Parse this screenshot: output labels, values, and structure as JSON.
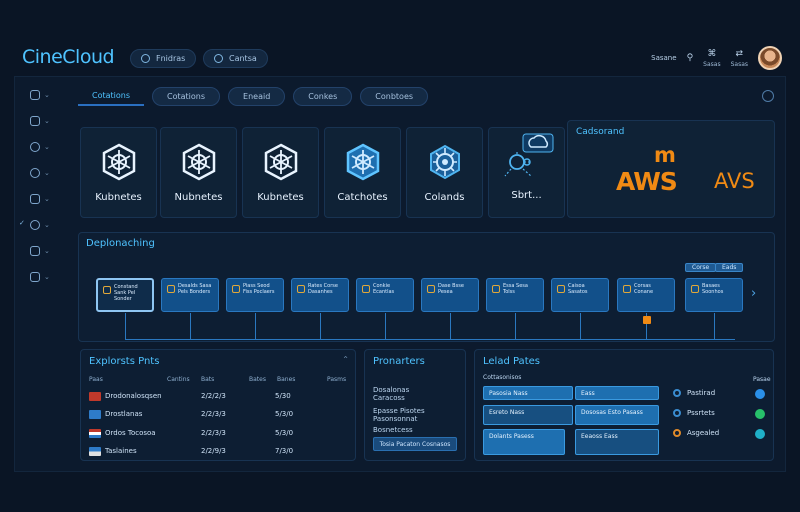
{
  "app": {
    "title": "CineCloud"
  },
  "top_nav": [
    {
      "label": "Fnidras"
    },
    {
      "label": "Cantsa"
    }
  ],
  "top_right": {
    "search_label": "Sasane",
    "items": [
      {
        "label": "Sasas",
        "icon": "network-icon"
      },
      {
        "label": "Sasas",
        "icon": "share-icon"
      }
    ]
  },
  "sidebar": {
    "items": [
      {
        "icon": "cluster-icon"
      },
      {
        "icon": "document-icon"
      },
      {
        "icon": "settings-icon"
      },
      {
        "icon": "clock-icon"
      },
      {
        "icon": "terminal-icon"
      },
      {
        "icon": "cloud-icon",
        "active": true
      },
      {
        "icon": "storage-icon"
      },
      {
        "icon": "shield-icon"
      }
    ]
  },
  "tabs": [
    {
      "label": "Cotations",
      "active": true
    },
    {
      "label": "Cotations"
    },
    {
      "label": "Eneaid"
    },
    {
      "label": "Conkes"
    },
    {
      "label": "Conbtoes"
    }
  ],
  "service_cards": [
    {
      "label": "Kubnetes"
    },
    {
      "label": "Nubnetes"
    },
    {
      "label": "Kubnetes"
    },
    {
      "label": "Catchotes"
    },
    {
      "label": "Colands"
    },
    {
      "label": "Sbrt..."
    }
  ],
  "aws_panel": {
    "header": "Cadsorand",
    "mark": "m",
    "logo_text": "AWS",
    "logo_text2": "AVS"
  },
  "pipeline": {
    "header": "Deplonaching",
    "controls": [
      "Corse",
      "Eads"
    ],
    "steps": [
      {
        "label": "Constand Sank Pel Sonder"
      },
      {
        "label": "Desalds Sasa Pels Bonders"
      },
      {
        "label": "Piass Seod Fiss Poclaers"
      },
      {
        "label": "Rates Corse Dasanhes"
      },
      {
        "label": "Conkie Ecantlas"
      },
      {
        "label": "Dase Bsse Pesea"
      },
      {
        "label": "Essa Sesa Tolss"
      },
      {
        "label": "Caisoa Sasatos"
      },
      {
        "label": "Corsas Conane"
      },
      {
        "label": "Basaes Soonhos"
      }
    ]
  },
  "explorer": {
    "header": "Explorsts Pnts",
    "columns": [
      "Paas",
      "Cantins",
      "Bats",
      "Bates",
      "Banes",
      "Pasms"
    ],
    "rows": [
      {
        "name": "Drodonalosqsen",
        "value": "2/2/2/3",
        "count": "5/30",
        "flag_color": "#c0392b"
      },
      {
        "name": "Drostlanas",
        "value": "2/2/3/3",
        "count": "5/3/0",
        "flag_color": "#2e7bc8"
      },
      {
        "name": "Ordos Tocosoa",
        "value": "2/2/3/3",
        "count": "5/3/0",
        "flag_color": "#d0d0d0"
      },
      {
        "name": "Taslaines",
        "value": "2/2/9/3",
        "count": "7/3/0",
        "flag_color": "#2e7bc8"
      }
    ]
  },
  "properties": {
    "header": "Pronarters",
    "lines": [
      "Dosalonas",
      "Caracoss",
      "Epasse Pisotes",
      "Pasonsonnat",
      "Bosnetcess"
    ],
    "button_label": "Tosia Pacaton Cosnasos"
  },
  "load_pates": {
    "header": "Lelad Pates",
    "subheader": "Cottasonisos",
    "boxes": [
      {
        "label": "Pasosia Nass"
      },
      {
        "label": "Esreto Nass"
      },
      {
        "label": "Dolants Pasess"
      },
      {
        "label": "Eass"
      },
      {
        "label": "Dososas Esto Pasass"
      },
      {
        "label": "Eeaoss Eass"
      }
    ],
    "status_header": "Pasae",
    "statuses": [
      {
        "label": "Pastirad",
        "dot_color": "#2a8fe8"
      },
      {
        "label": "Pssrtets",
        "dot_color": "#27c06a"
      },
      {
        "label": "Asgealed",
        "dot_color": "#1fb0c8"
      }
    ]
  }
}
